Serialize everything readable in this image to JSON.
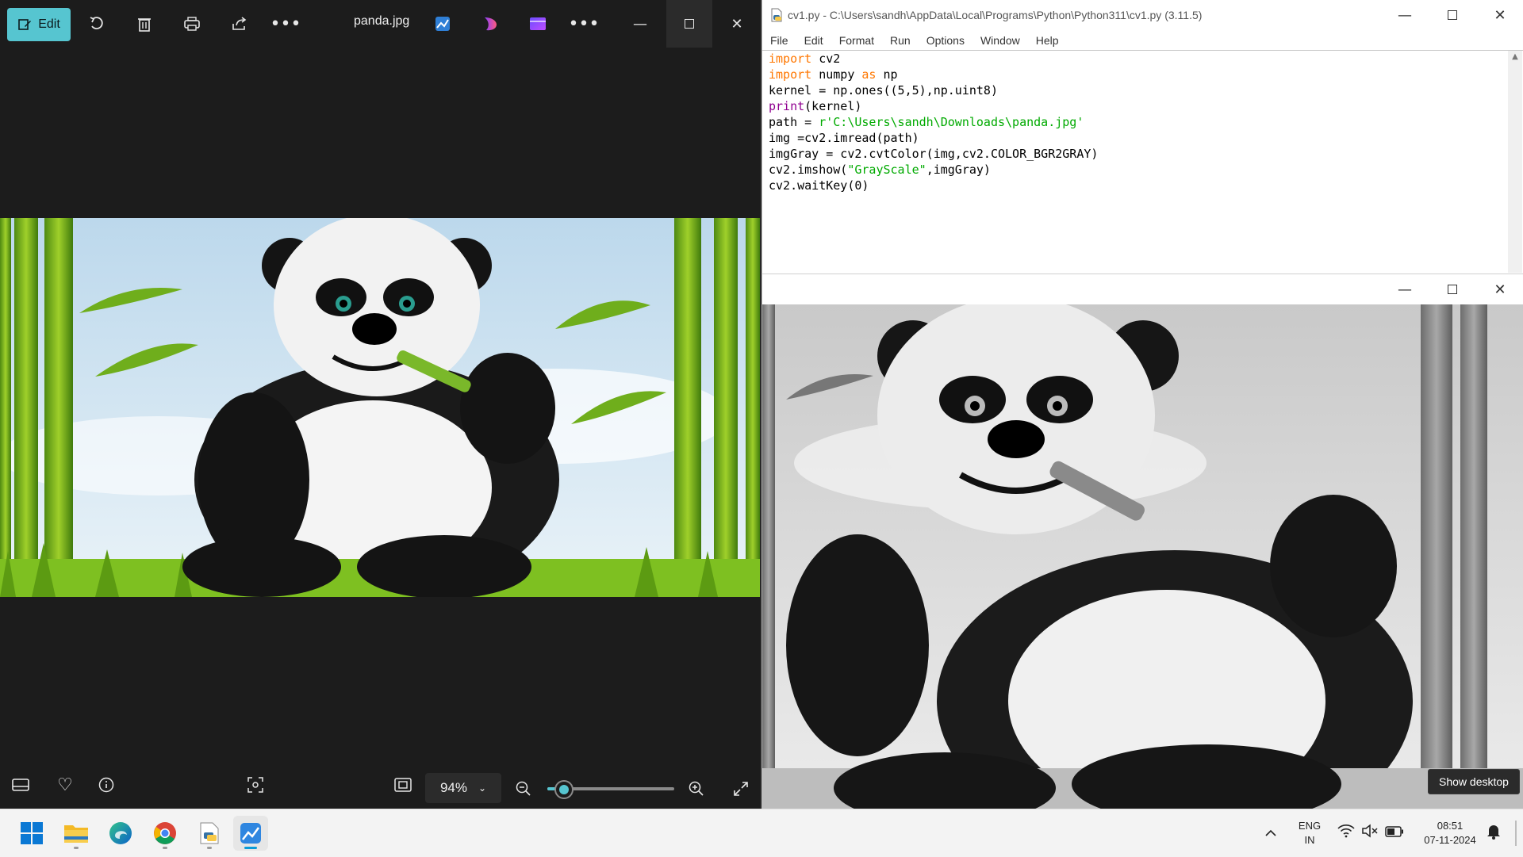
{
  "photos": {
    "edit_label": "Edit",
    "filename": "panda.jpg",
    "zoom": "94%",
    "zoom_level_percent": 94,
    "icons": [
      "edit-icon",
      "rotate-icon",
      "delete-icon",
      "print-icon",
      "share-icon",
      "more-icon",
      "photo-editor-icon",
      "designer-icon",
      "clipchamp-icon",
      "more-icon",
      "minimize-icon",
      "maximize-icon",
      "close-icon"
    ],
    "bottom_icons": [
      "filmstrip-icon",
      "favorite-icon",
      "info-icon",
      "visual-search-icon",
      "actual-size-icon",
      "zoom-out-icon",
      "zoom-in-icon",
      "fullscreen-icon"
    ]
  },
  "idle": {
    "title": "cv1.py - C:\\Users\\sandh\\AppData\\Local\\Programs\\Python\\Python311\\cv1.py (3.11.5)",
    "menu": [
      "File",
      "Edit",
      "Format",
      "Run",
      "Options",
      "Window",
      "Help"
    ],
    "code": {
      "l1_kw": "import",
      "l1_rest": " cv2",
      "l2_kw": "import",
      "l2_mid": " numpy ",
      "l2_as": "as",
      "l2_rest": " np",
      "l3": "kernel = np.ones((5,5),np.uint8)",
      "l4_bi": "print",
      "l4_rest": "(kernel)",
      "l5_a": "path = ",
      "l5_str": "r'C:\\Users\\sandh\\Downloads\\panda.jpg'",
      "l6": "img =cv2.imread(path)",
      "l7": "imgGray = cv2.cvtColor(img,cv2.COLOR_BGR2GRAY)",
      "l8_a": "cv2.imshow(",
      "l8_str": "\"GrayScale\"",
      "l8_rest": ",imgGray)",
      "l9": "cv2.waitKey(0)"
    }
  },
  "tooltip": "Show desktop",
  "taskbar": {
    "apps": [
      "start-icon",
      "file-explorer-icon",
      "edge-icon",
      "chrome-icon",
      "notepad-icon",
      "photos-icon"
    ],
    "lang_top": "ENG",
    "lang_bottom": "IN",
    "time": "08:51",
    "date": "07-11-2024"
  },
  "colors": {
    "accent": "#56c5d0",
    "keyword": "#ff7700",
    "builtin": "#900090",
    "string": "#00aa00"
  }
}
